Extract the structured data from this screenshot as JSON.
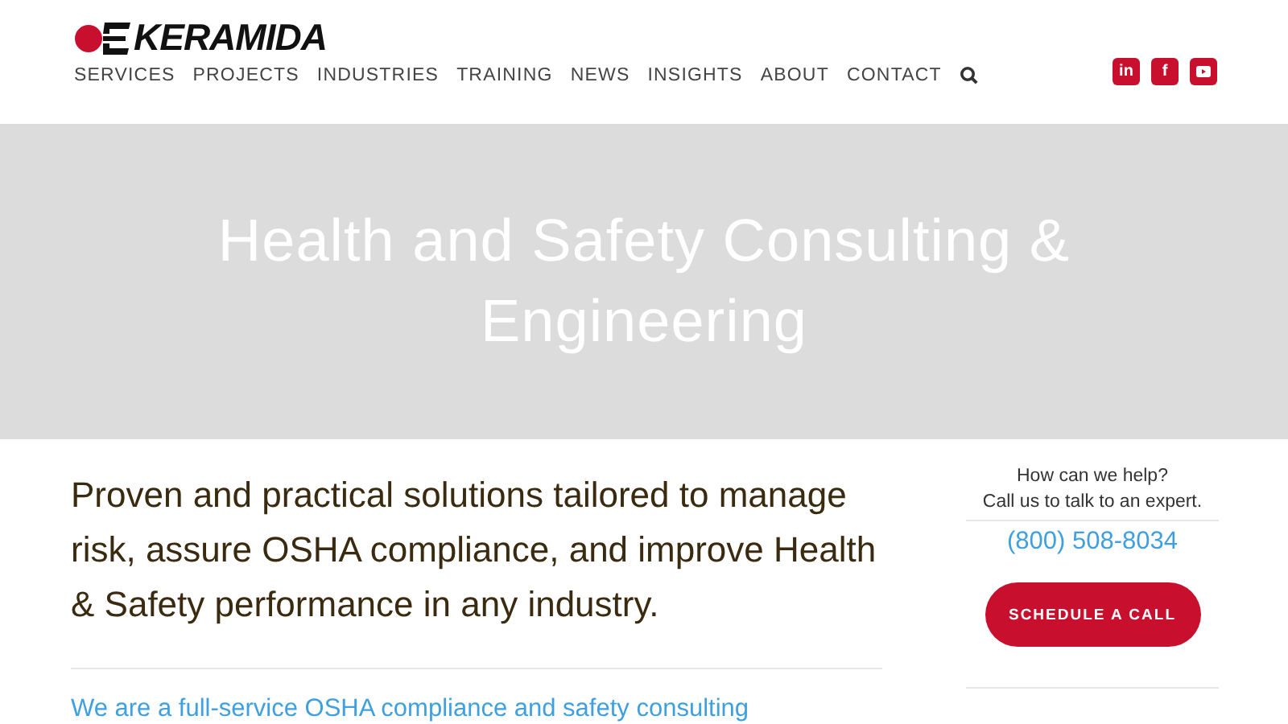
{
  "logo": {
    "text": "KERAMIDA"
  },
  "nav": {
    "items": [
      {
        "label": "SERVICES"
      },
      {
        "label": "PROJECTS"
      },
      {
        "label": "INDUSTRIES"
      },
      {
        "label": "TRAINING"
      },
      {
        "label": "NEWS"
      },
      {
        "label": "INSIGHTS"
      },
      {
        "label": "ABOUT"
      },
      {
        "label": "CONTACT"
      }
    ]
  },
  "social": [
    {
      "kind": "text",
      "label": "in"
    },
    {
      "kind": "text",
      "label": "f"
    },
    {
      "kind": "video"
    }
  ],
  "hero": {
    "title": "Health and Safety Consulting & Engineering"
  },
  "intro": "Proven and practical solutions tailored to manage risk, assure OSHA compliance, and improve Health & Safety performance in any industry.",
  "lead": "We are a full-service OSHA compliance and safety consulting",
  "sidebar": {
    "question": "How can we help?",
    "prompt": "Call us to talk to an expert.",
    "phone": "(800) 508-8034",
    "button": "SCHEDULE A CALL"
  }
}
